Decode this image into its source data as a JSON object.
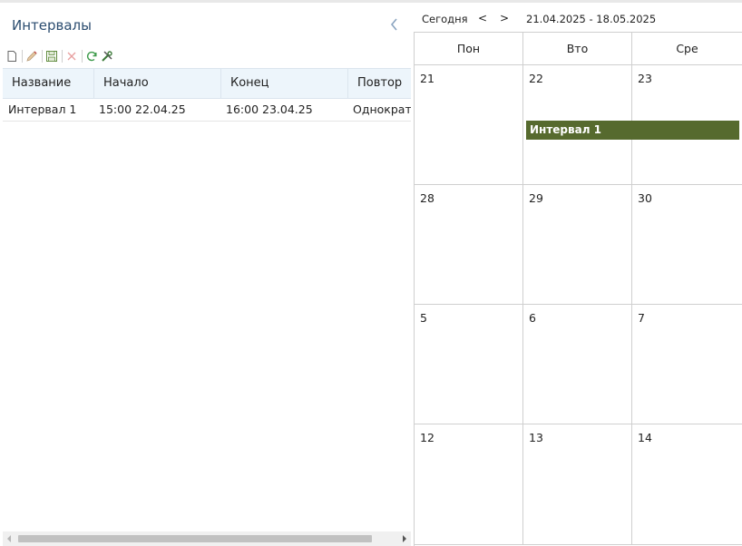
{
  "panel": {
    "title": "Интервалы",
    "collapse_icon": "chevron-left-icon"
  },
  "toolbar": {
    "icons": [
      "new-document-icon",
      "edit-pencil-icon",
      "save-icon",
      "delete-icon",
      "refresh-icon",
      "settings-tools-icon"
    ]
  },
  "table": {
    "columns": [
      "Название",
      "Начало",
      "Конец",
      "Повтор"
    ],
    "rows": [
      {
        "name": "Интервал 1",
        "start": "15:00 22.04.25",
        "end": "16:00 23.04.25",
        "repeat": "Однократно"
      }
    ]
  },
  "calendar": {
    "today_label": "Сегодня",
    "prev_label": "<",
    "next_label": ">",
    "range": "21.04.2025 - 18.05.2025",
    "days": [
      "Пон",
      "Вто",
      "Сре"
    ],
    "weeks": [
      [
        "21",
        "22",
        "23"
      ],
      [
        "28",
        "29",
        "30"
      ],
      [
        "5",
        "6",
        "7"
      ],
      [
        "12",
        "13",
        "14"
      ]
    ],
    "event": {
      "title": "Интервал 1",
      "color": "#566a2e"
    }
  },
  "colors": {
    "title": "#2c4d70",
    "header_bg": "#edf5fb",
    "grid_line": "#cfcfcf"
  }
}
